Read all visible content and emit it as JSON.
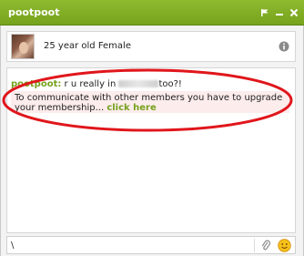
{
  "window": {
    "title": "pootpoot",
    "icons": [
      "flag-icon",
      "minimize-icon",
      "close-icon"
    ]
  },
  "profile": {
    "description": "25 year old Female",
    "info_icon": "info-icon"
  },
  "chat": {
    "messages": [
      {
        "sender": "pootpoot:",
        "text_before": " r u really in ",
        "text_after": "too?!"
      }
    ],
    "upgrade_notice": {
      "text": "To communicate with other members you have to upgrade your membership...",
      "link": "click here"
    }
  },
  "input": {
    "value": "\\",
    "icons": [
      "attachment-icon",
      "smiley-icon"
    ]
  },
  "colors": {
    "titlebar": "#7fae22",
    "accent_green": "#75a21c",
    "notice_bg": "#fcecec",
    "annotation_red": "#e0161b"
  }
}
